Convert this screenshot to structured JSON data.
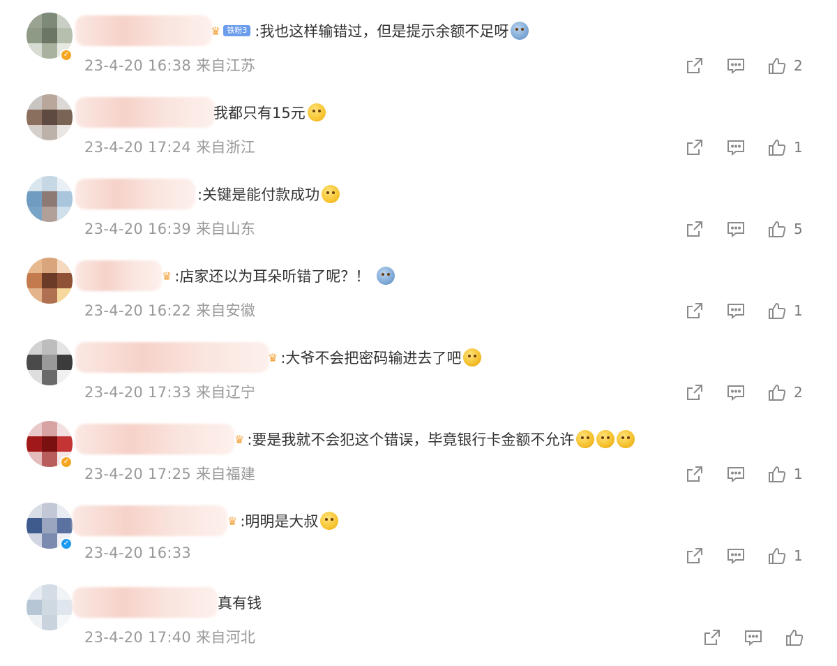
{
  "comments": [
    {
      "id": 0,
      "badge": "铁粉3",
      "text": ":我也这样输错过，但是提示余额不足呀",
      "meta": "23-4-20 16:38 来自江苏",
      "likes": "2",
      "emojis": [
        "cry-emoji"
      ]
    },
    {
      "id": 1,
      "text": "我都只有15元",
      "meta": "23-4-20 17:24 来自浙江",
      "likes": "1",
      "emojis": [
        "doge-emoji"
      ]
    },
    {
      "id": 2,
      "text": ":关键是能付款成功",
      "meta": "23-4-20 16:39 来自山东",
      "likes": "5",
      "emojis": [
        "sob-emoji"
      ]
    },
    {
      "id": 3,
      "text": ":店家还以为耳朵听错了呢？！",
      "meta": "23-4-20 16:22 来自安徽",
      "likes": "1",
      "emojis": [
        "crying-face-emoji"
      ]
    },
    {
      "id": 4,
      "text": ":大爷不会把密码输进去了吧",
      "meta": "23-4-20 17:33 来自辽宁",
      "likes": "2",
      "emojis": [
        "laugh-emoji"
      ]
    },
    {
      "id": 5,
      "text": ":要是我就不会犯这个错误，毕竟银行卡金额不允许",
      "meta": "23-4-20 17:25 来自福建",
      "likes": "1",
      "emojis": [
        "laugh-emoji",
        "laugh-emoji",
        "laugh-emoji"
      ]
    },
    {
      "id": 6,
      "text": ":明明是大叔",
      "meta": "23-4-20 16:33",
      "likes": "1",
      "emojis": [
        "doge-emoji"
      ]
    },
    {
      "id": 7,
      "text": "真有钱",
      "meta": "23-4-20 17:40 来自河北",
      "likes": "",
      "emojis": []
    }
  ],
  "colors": {
    "text": "#333333",
    "meta": "#999999",
    "icon": "#8a8a8a",
    "badge": "#6c9cec",
    "verified_gold": "#f5a623",
    "verified_blue": "#1d9bf0"
  },
  "icons": {
    "share": "share-icon",
    "comment": "comment-icon",
    "like": "thumbs-up-icon"
  }
}
